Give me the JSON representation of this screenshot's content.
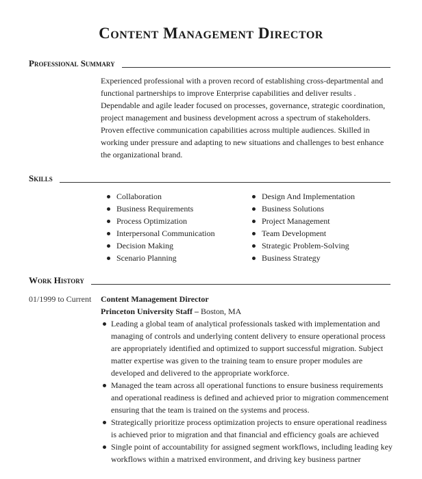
{
  "title": "Content Management Director",
  "sections": {
    "summary": {
      "heading": "Professional Summary",
      "text": "Experienced professional with a proven record of establishing cross-departmental and functional partnerships to improve Enterprise capabilities and deliver results . Dependable and agile leader focused on processes, governance, strategic coordination, project management and business development across a spectrum of stakeholders. Proven effective communication capabilities across multiple audiences. Skilled in working under pressure and adapting to new situations and challenges to best enhance the organizational brand."
    },
    "skills": {
      "heading": "Skills",
      "left": [
        "Collaboration",
        "Business Requirements",
        "Process Optimization",
        "Interpersonal Communication",
        "Decision Making",
        "Scenario Planning"
      ],
      "right": [
        "Design And Implementation",
        "Business Solutions",
        "Project Management",
        "Team Development",
        "Strategic Problem-Solving",
        "Business Strategy"
      ]
    },
    "work_history": {
      "heading": "Work History",
      "jobs": [
        {
          "dates": "01/1999 to Current",
          "title": "Content Management Director",
          "company": "Princeton University Staff",
          "separator": " – ",
          "location": "Boston, MA",
          "bullets": [
            "Leading a global team of analytical professionals tasked with implementation and managing of controls and underlying content delivery to ensure operational process are appropriately identified and optimized to support successful migration. Subject matter expertise was given to the training team to ensure proper modules are developed and delivered to the appropriate workforce.",
            "Managed the team across all operational functions to ensure business requirements and operational readiness is defined and achieved prior to migration commencement ensuring that the team is trained on the systems and process.",
            "Strategically prioritize process optimization projects to ensure operational readiness is achieved prior to migration and that financial and efficiency goals are achieved",
            "Single point of accountability for assigned segment workflows, including leading key workflows within a matrixed environment, and driving key business partner"
          ]
        }
      ]
    }
  }
}
